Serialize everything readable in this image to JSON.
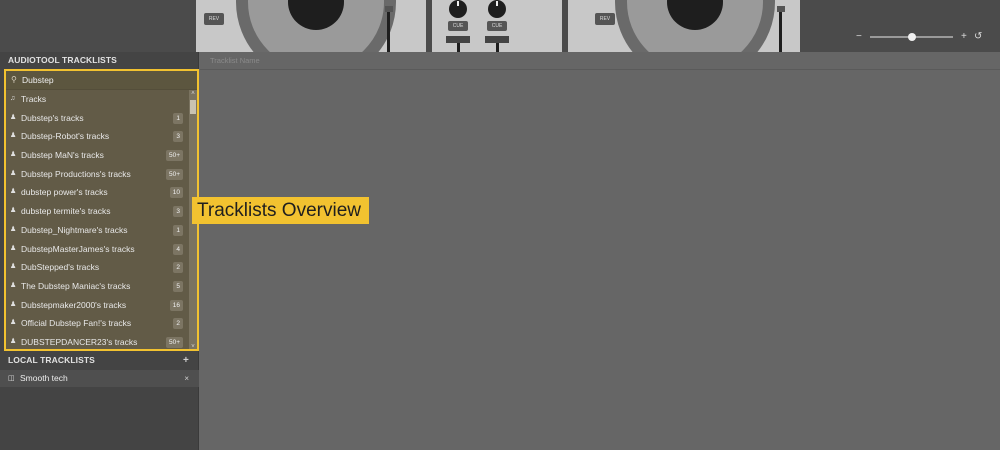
{
  "deck": {
    "left_rev": "REV",
    "right_rev": "REV",
    "cue_left": "CUE",
    "cue_right": "CUE"
  },
  "zoom": {
    "minus_icon": "minus-icon",
    "plus_icon": "plus-icon",
    "reset_icon": "reset-icon",
    "level": 0.5
  },
  "sidebar": {
    "audiotool_title": "AUDIOTOOL TRACKLISTS",
    "search_value": "Dubstep",
    "tracks_label": "Tracks",
    "items": [
      {
        "label": "Dubstep's tracks",
        "count": "1"
      },
      {
        "label": "Dubstep-Robot's tracks",
        "count": "3"
      },
      {
        "label": "Dubstep MaN's tracks",
        "count": "50+"
      },
      {
        "label": "Dubstep Productions's tracks",
        "count": "50+"
      },
      {
        "label": "dubstep power's tracks",
        "count": "10"
      },
      {
        "label": "dubstep termite's tracks",
        "count": "3"
      },
      {
        "label": "Dubstep_Nightmare's tracks",
        "count": "1"
      },
      {
        "label": "DubstepMasterJames's tracks",
        "count": "4"
      },
      {
        "label": "DubStepped's tracks",
        "count": "2"
      },
      {
        "label": "The Dubstep Maniac's tracks",
        "count": "5"
      },
      {
        "label": "Dubstepmaker2000's tracks",
        "count": "16"
      },
      {
        "label": "Official Dubstep Fan!'s tracks",
        "count": "2"
      },
      {
        "label": "DUBSTEPDANCER23's tracks",
        "count": "50+"
      }
    ],
    "local_title": "LOCAL TRACKLISTS",
    "local_add": "+",
    "local_items": [
      {
        "label": "Smooth tech",
        "remove": "×"
      }
    ]
  },
  "main": {
    "column_header": "Tracklist Name"
  },
  "callout": {
    "text": "Tracklists Overview",
    "color": "#f2c230"
  }
}
